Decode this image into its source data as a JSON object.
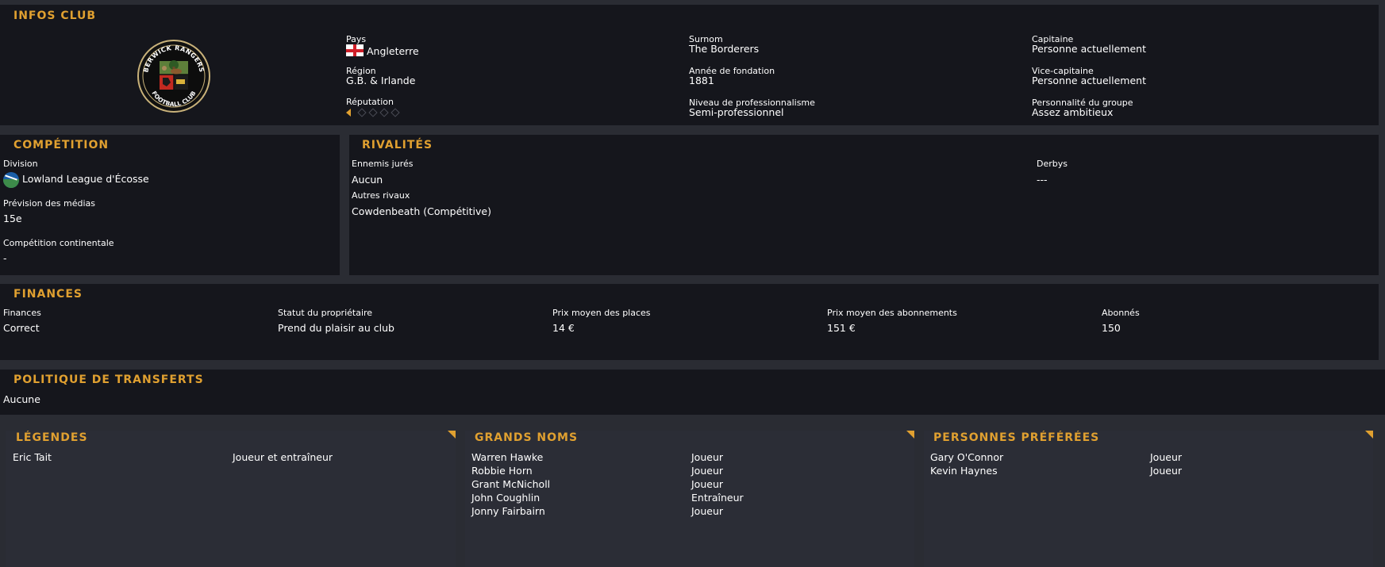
{
  "infos_club": {
    "title": "INFOS CLUB",
    "logo": {
      "top_text": "BERWICK RANGERS",
      "bottom_text": "FOOTBALL CLUB"
    },
    "pays_label": "Pays",
    "pays_value": "Angleterre",
    "region_label": "Région",
    "region_value": "G.B. & Irlande",
    "reputation_label": "Réputation",
    "reputation_stars": 0.5,
    "surnom_label": "Surnom",
    "surnom_value": "The Borderers",
    "annee_label": "Année de fondation",
    "annee_value": "1881",
    "niveau_label": "Niveau de professionnalisme",
    "niveau_value": "Semi-professionnel",
    "capitaine_label": "Capitaine",
    "capitaine_value": "Personne actuellement",
    "vice_label": "Vice-capitaine",
    "vice_value": "Personne actuellement",
    "personnalite_label": "Personnalité du groupe",
    "personnalite_value": "Assez ambitieux"
  },
  "competition": {
    "title": "COMPÉTITION",
    "division_label": "Division",
    "division_value": "Lowland League d'Écosse",
    "prevision_label": "Prévision des médias",
    "prevision_value": "15e",
    "continentale_label": "Compétition continentale",
    "continentale_value": "-"
  },
  "rivalites": {
    "title": "RIVALITÉS",
    "ennemis_label": "Ennemis jurés",
    "ennemis_value": "Aucun",
    "autres_label": "Autres rivaux",
    "autres_value": "Cowdenbeath (Compétitive)",
    "derbys_label": "Derbys",
    "derbys_value": "---"
  },
  "finances": {
    "title": "FINANCES",
    "cols": [
      {
        "label": "Finances",
        "value": "Correct"
      },
      {
        "label": "Statut du propriétaire",
        "value": "Prend du plaisir au club"
      },
      {
        "label": "Prix moyen des places",
        "value": "14 €"
      },
      {
        "label": "Prix moyen des abonnements",
        "value": "151 €"
      },
      {
        "label": "Abonnés",
        "value": "150"
      }
    ]
  },
  "transferts": {
    "title": "POLITIQUE DE TRANSFERTS",
    "value": "Aucune"
  },
  "legendes": {
    "title": "LÉGENDES",
    "items": [
      {
        "name": "Eric Tait",
        "role": "Joueur et entraîneur"
      }
    ]
  },
  "grands_noms": {
    "title": "GRANDS NOMS",
    "items": [
      {
        "name": "Warren Hawke",
        "role": "Joueur"
      },
      {
        "name": "Robbie Horn",
        "role": "Joueur"
      },
      {
        "name": "Grant McNicholl",
        "role": "Joueur"
      },
      {
        "name": "John Coughlin",
        "role": "Entraîneur"
      },
      {
        "name": "Jonny Fairbairn",
        "role": "Joueur"
      }
    ]
  },
  "personnes": {
    "title": "PERSONNES PRÉFÉRÉES",
    "items": [
      {
        "name": "Gary O'Connor",
        "role": "Joueur"
      },
      {
        "name": "Kevin Haynes",
        "role": "Joueur"
      }
    ]
  },
  "colors": {
    "accent": "#e0a030",
    "panel": "#15161c",
    "background": "#2a2c33",
    "card": "#2b2d36"
  }
}
